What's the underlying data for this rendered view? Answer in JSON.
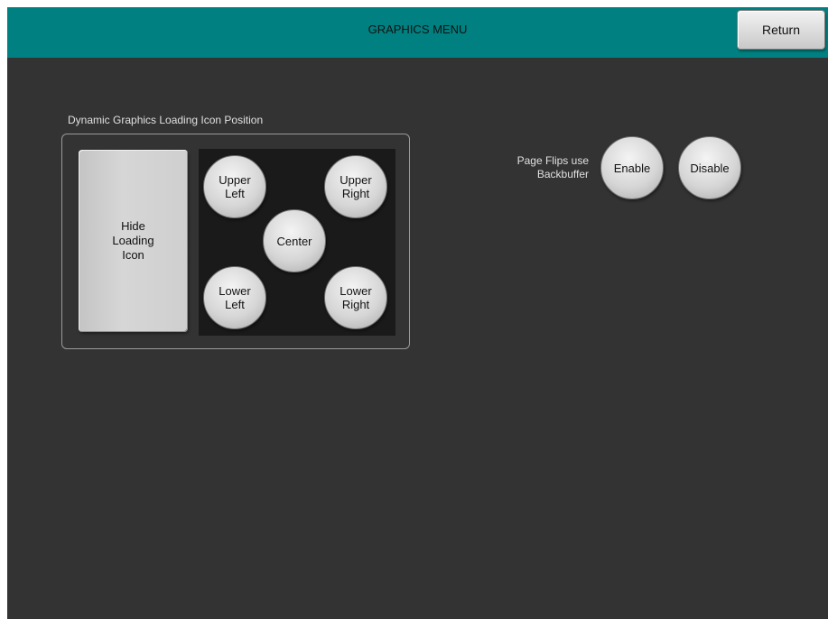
{
  "header": {
    "title": "GRAPHICS MENU",
    "return_label": "Return"
  },
  "loading_icon": {
    "section_label": "Dynamic Graphics Loading Icon Position",
    "hide_label": [
      "Hide",
      "Loading",
      "Icon"
    ],
    "positions": {
      "upper_left": [
        "Upper",
        "Left"
      ],
      "upper_right": [
        "Upper",
        "Right"
      ],
      "center": [
        "Center"
      ],
      "lower_left": [
        "Lower",
        "Left"
      ],
      "lower_right": [
        "Lower",
        "Right"
      ]
    }
  },
  "page_flips": {
    "label": [
      "Page Flips use",
      "Backbuffer"
    ],
    "enable_label": "Enable",
    "disable_label": "Disable"
  }
}
